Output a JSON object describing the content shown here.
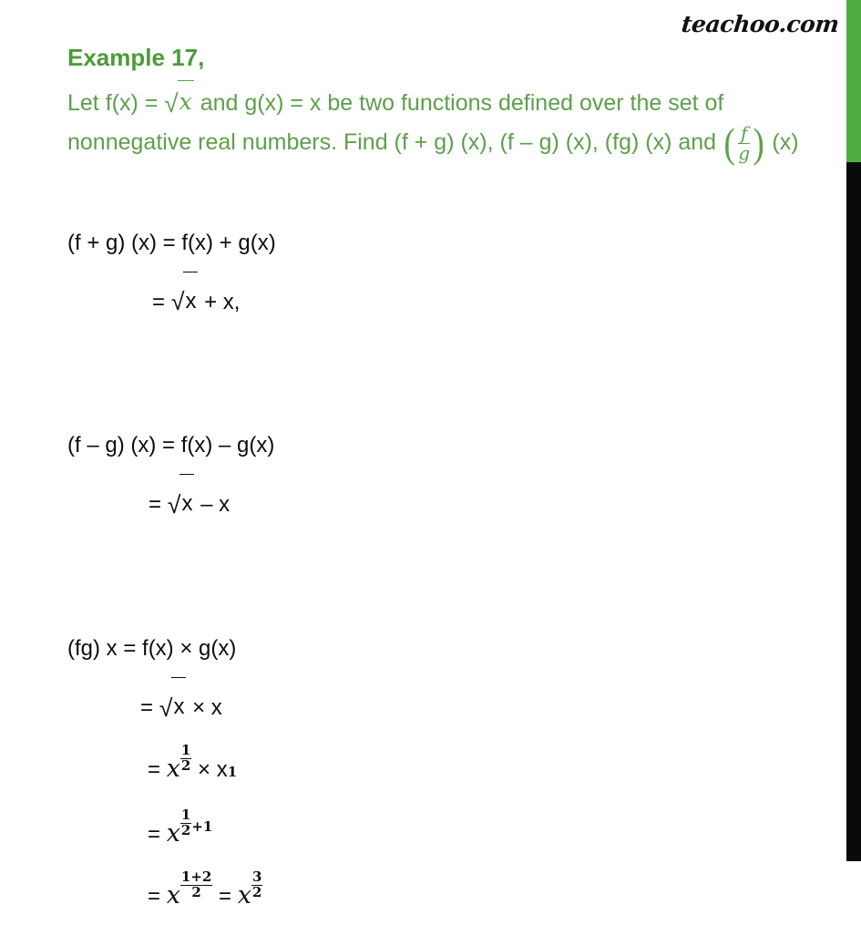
{
  "brand": {
    "text": "teachoo.com"
  },
  "colors": {
    "heading_green": "#4e9a3a",
    "body_green": "#5da04b",
    "bar_green": "#4caf3e",
    "bar_black": "#0a0a0a",
    "solution_text": "#0d0d0d"
  },
  "question": {
    "heading": "Example 17,",
    "line1_a": "Let f(x) = ",
    "line1_sqrt_radicand": "x",
    "line1_b": " and g(x) = x be two functions defined over the set of nonnegative real numbers. Find (f + g) (x), (f – g) (x), (fg) (x) and ",
    "frac_numerator": "f",
    "frac_denominator": "g",
    "line1_c": " (x)",
    "paren_open": "(",
    "paren_close": ")"
  },
  "solution": {
    "sum": {
      "main": "(f + g) (x) = f(x) + g(x)",
      "cont_prefix": "=  ",
      "cont_radicand": "x",
      "cont_suffix": " + x,"
    },
    "difference": {
      "main": "(f – g) (x) = f(x) – g(x)",
      "cont_prefix": "=  ",
      "cont_radicand": "x",
      "cont_suffix": " – x"
    },
    "product": {
      "main": "(fg) x = f(x) × g(x)",
      "step1_prefix": "=   ",
      "step1_radicand": "x",
      "step1_suffix": " × x",
      "step2_eq": "=  ",
      "step2_base": "x",
      "step2_exp_num": "1",
      "step2_exp_den": "2",
      "step2_mid": " × x",
      "step2_sup2": "1",
      "step3_eq": "=  ",
      "step3_base": "x",
      "step3_exp_num": "1",
      "step3_exp_den": "2",
      "step3_exp_tail": "+1",
      "step4_eq": "=  ",
      "step4_base": "x",
      "step4_exp_num": "1+2",
      "step4_exp_den": "2",
      "step4_eq2": "  =  ",
      "step4_base2": "x",
      "step4_exp2_num": "3",
      "step4_exp2_den": "2"
    }
  }
}
